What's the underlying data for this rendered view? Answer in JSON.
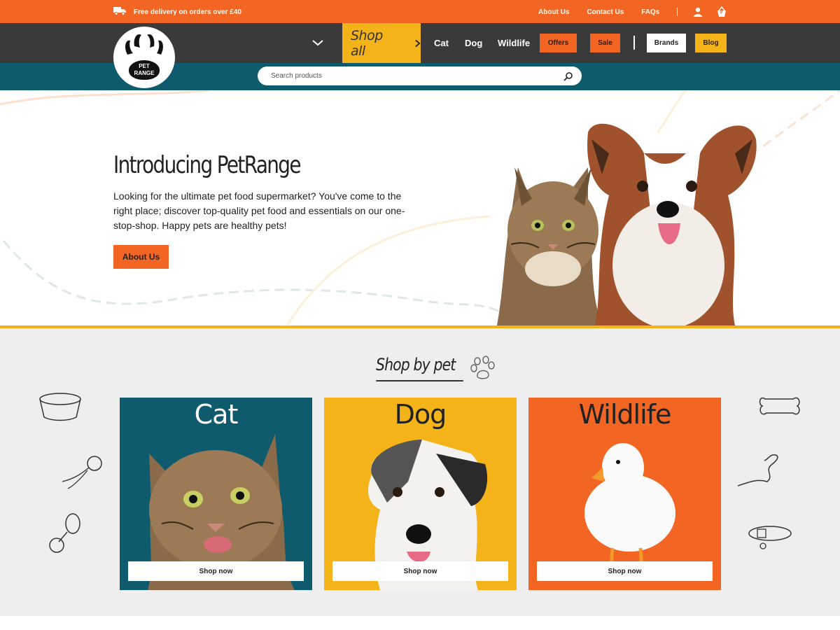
{
  "topbar": {
    "delivery_text": "Free delivery on orders over £40",
    "links": [
      "About Us",
      "Contact Us",
      "FAQs"
    ],
    "cart_count": "0"
  },
  "logo": {
    "text_line1": "PET",
    "text_line2": "RANGE"
  },
  "nav": {
    "shop_all": "Shop all",
    "links": [
      "Cat",
      "Dog",
      "Wildlife"
    ],
    "buttons": [
      "Offers",
      "Sale",
      "Brands",
      "Blog"
    ]
  },
  "search": {
    "placeholder": "Search products"
  },
  "hero": {
    "title": "Introducing PetRange",
    "body": "Looking for the ultimate pet food supermarket? You've come to the right place; discover top-quality pet food and essentials on our one-stop-shop. Happy pets are healthy pets!",
    "button": "About Us"
  },
  "shop_by_pet": {
    "title": "Shop by pet",
    "cards": [
      {
        "title": "Cat",
        "button": "Shop now",
        "bg": "#0e5b6d"
      },
      {
        "title": "Dog",
        "button": "Shop now",
        "bg": "#f5b31a"
      },
      {
        "title": "Wildlife",
        "button": "Shop now",
        "bg": "#f26522"
      }
    ]
  },
  "colors": {
    "orange": "#f26522",
    "yellow": "#f5b31a",
    "teal": "#0e5b6d",
    "dark": "#3a3a3a"
  }
}
